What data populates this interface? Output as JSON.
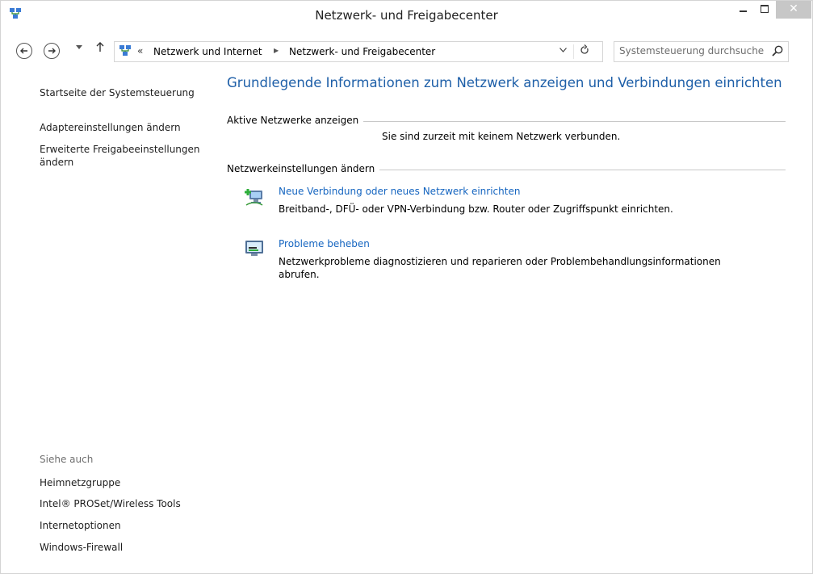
{
  "window": {
    "title": "Netzwerk- und Freigabecenter",
    "close_glyph": "✕"
  },
  "nav": {
    "breadcrumb_sep": "«",
    "crumb_1": "Netzwerk und Internet",
    "crumb_arrow": "▶",
    "crumb_2": "Netzwerk- und Freigabecenter",
    "search_placeholder": "Systemsteuerung durchsuchen"
  },
  "sidebar": {
    "home": "Startseite der Systemsteuerung",
    "adapter": "Adaptereinstellungen ändern",
    "advanced": "Erweiterte Freigabeeinstellungen ändern",
    "see_also_heading": "Siehe auch",
    "see_also": [
      "Heimnetzgruppe",
      "Intel® PROSet/Wireless Tools",
      "Internetoptionen",
      "Windows-Firewall"
    ]
  },
  "main": {
    "title": "Grundlegende Informationen zum Netzwerk anzeigen und Verbindungen einrichten",
    "active_networks_heading": "Aktive Netzwerke anzeigen",
    "status": "Sie sind zurzeit mit keinem Netzwerk verbunden.",
    "change_settings_heading": "Netzwerkeinstellungen ändern",
    "tasks": [
      {
        "link": "Neue Verbindung oder neues Netzwerk einrichten",
        "description": "Breitband-, DFÜ- oder VPN-Verbindung bzw. Router oder Zugriffspunkt einrichten.",
        "icon": "new-connection-icon"
      },
      {
        "link": "Probleme beheben",
        "description": "Netzwerkprobleme diagnostizieren und reparieren oder Problembehandlungsinformationen abrufen.",
        "icon": "troubleshoot-icon"
      }
    ]
  },
  "colors": {
    "title_blue": "#1e5fa8",
    "link_blue": "#1565c0",
    "close_button": "#c7c7c7"
  }
}
